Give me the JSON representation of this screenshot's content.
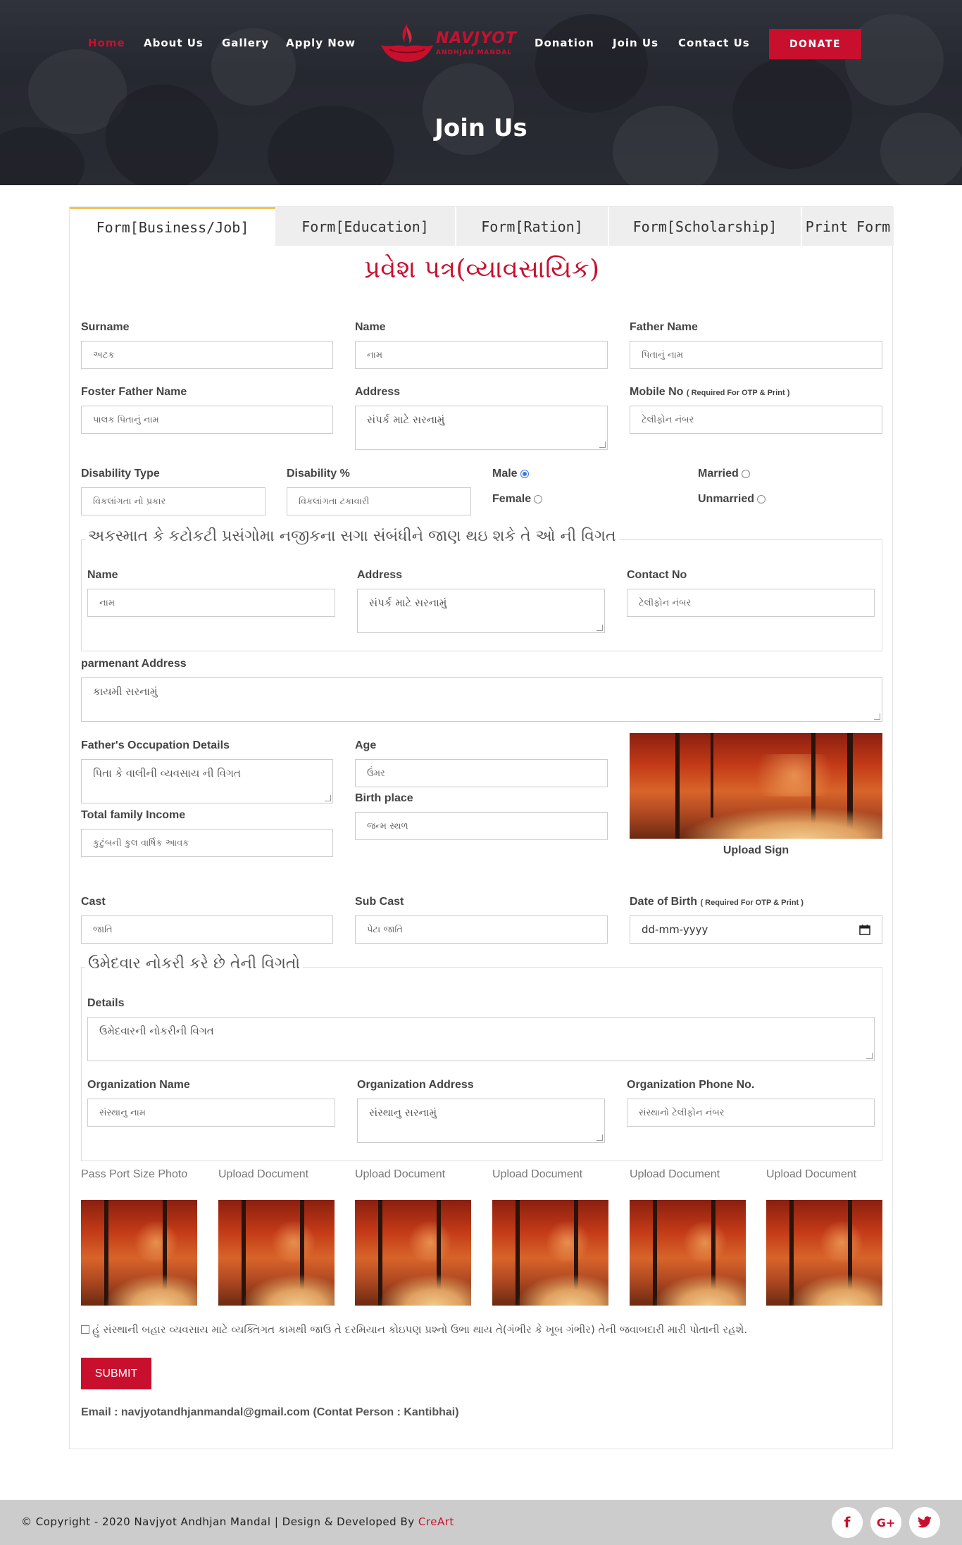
{
  "nav": {
    "items": [
      {
        "label": "Home",
        "active": true
      },
      {
        "label": "About Us"
      },
      {
        "label": "Gallery"
      },
      {
        "label": "Apply Now"
      },
      {
        "label": "Donation"
      },
      {
        "label": "Join Us"
      },
      {
        "label": "Contact Us"
      }
    ],
    "logo": {
      "title": "NAVJYOT",
      "subtitle": "ANDHJAN MANDAL"
    },
    "donate_label": "DONATE"
  },
  "page": {
    "title": "Join Us"
  },
  "tabs": [
    {
      "label": "Form[Business/Job]",
      "active": true
    },
    {
      "label": "Form[Education]"
    },
    {
      "label": "Form[Ration]"
    },
    {
      "label": "Form[Scholarship]"
    },
    {
      "label": "Print Form"
    }
  ],
  "form": {
    "title": "પ્રવેશ પત્ર(વ્યાવસાયિક)",
    "surname": {
      "label": "Surname",
      "placeholder": "અટક"
    },
    "name": {
      "label": "Name",
      "placeholder": "નામ"
    },
    "father_name": {
      "label": "Father Name",
      "placeholder": "પિતાનું નામ"
    },
    "foster_father": {
      "label": "Foster Father Name",
      "placeholder": "પાલક પિતાનું નામ"
    },
    "address": {
      "label": "Address",
      "placeholder": "સંપર્ક માટે સરનામું"
    },
    "mobile": {
      "label": "Mobile No",
      "note": "( Required For OTP & Print )",
      "placeholder": "ટેલીફોન નંબર"
    },
    "disability_type": {
      "label": "Disability Type",
      "placeholder": "વિકલાંગતા નો પ્રકાર"
    },
    "disability_pct": {
      "label": "Disability %",
      "placeholder": "વિકલાંગતા ટકાવારી"
    },
    "gender": {
      "male": "Male",
      "female": "Female",
      "selected": "Male"
    },
    "marital": {
      "married": "Married",
      "unmarried": "Unmarried"
    },
    "emergency": {
      "legend": "અકસ્માત કે કટોકટી પ્રસંગોમા નજીકના સગા સંબંધીને જાણ થઇ શકે તે ઓ ની વિગત",
      "name": {
        "label": "Name",
        "placeholder": "નામ"
      },
      "address": {
        "label": "Address",
        "placeholder": "સંપર્ક માટે સરનામું"
      },
      "contact": {
        "label": "Contact No",
        "placeholder": "ટેલીફોન નંબર"
      }
    },
    "permanent_address": {
      "label": "parmenant Address",
      "placeholder": "કાયમી સરનામું"
    },
    "father_occupation": {
      "label": "Father's Occupation Details",
      "placeholder": "પિતા કે વાલીની વ્યવસાય ની વિગત"
    },
    "age": {
      "label": "Age",
      "placeholder": "ઉંમર"
    },
    "birth_place": {
      "label": "Birth place",
      "placeholder": "જન્મ સ્થળ"
    },
    "family_income": {
      "label": "Total family Income",
      "placeholder": "કુટુંબની કુલ વાર્ષિક આવક"
    },
    "upload_sign": "Upload Sign",
    "cast": {
      "label": "Cast",
      "placeholder": "જાતિ"
    },
    "sub_cast": {
      "label": "Sub Cast",
      "placeholder": "પેટા જાતિ"
    },
    "dob": {
      "label": "Date of Birth",
      "note": "( Required For OTP & Print )",
      "placeholder": "dd-mm-yyyy"
    },
    "job": {
      "legend": "ઉમેદવાર નોકરી કરે છે તેની વિગતો",
      "details": {
        "label": "Details",
        "placeholder": "ઉમેદવારની નોકરીની વિગત"
      },
      "org_name": {
        "label": "Organization Name",
        "placeholder": "સંસ્થાનુ નામ"
      },
      "org_address": {
        "label": "Organization Address",
        "placeholder": "સંસ્થાનુ સરનામું"
      },
      "org_phone": {
        "label": "Organization Phone No.",
        "placeholder": "સંસ્થાનો ટેલીફોન નંબર"
      }
    },
    "documents": [
      "Pass Port Size Photo",
      "Upload Document",
      "Upload Document",
      "Upload Document",
      "Upload Document",
      "Upload Document"
    ],
    "declaration": "હું સંસ્થાની બહાર વ્યવસાય માટે વ્યક્તિગત કામથી જાઉ તે દરમિયાન કોઇપણ પ્રશ્નો ઉભા થાય તે(ગંભીર કે ખૂબ ગંભીર) તેની જવાબદારી મારી પોતાની રહશે.",
    "submit_label": "SUBMIT",
    "contact_line": "Email : navjyotandhjanmandal@gmail.com (Contat Person : Kantibhai)"
  },
  "footer": {
    "copyright": "© Copyright - 2020 Navjyot Andhjan Mandal | Design & Developed By",
    "developer": "CreArt",
    "social": [
      {
        "icon": "facebook-icon",
        "glyph": "f"
      },
      {
        "icon": "google-plus-icon",
        "glyph": "G+"
      },
      {
        "icon": "twitter-icon",
        "glyph": "t"
      }
    ]
  },
  "colors": {
    "brand": "#c8102e",
    "tab_accent": "#f4c25c",
    "footer_bg": "#cccccc"
  }
}
